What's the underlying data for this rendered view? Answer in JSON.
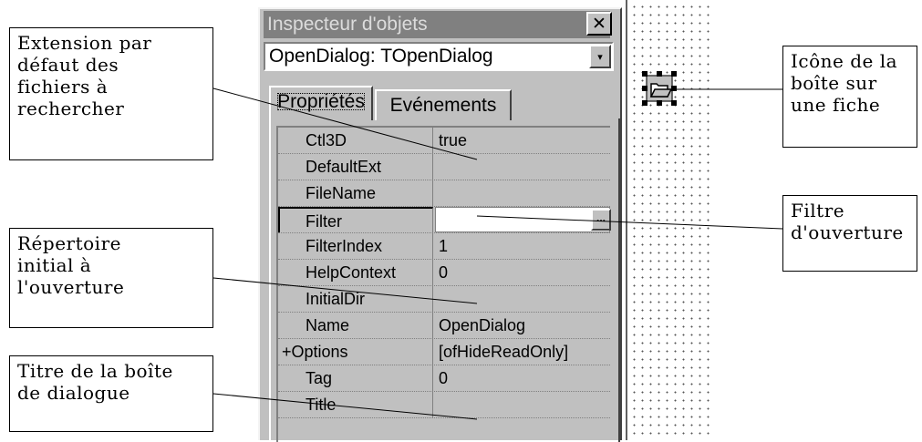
{
  "inspector": {
    "title": "Inspecteur d'objets",
    "close_glyph": "✕",
    "object_selector": {
      "value": "OpenDialog: TOpenDialog",
      "arrow_glyph": "▾"
    },
    "tabs": [
      {
        "label": "Propriétés",
        "active": true
      },
      {
        "label": "Evénements",
        "active": false
      }
    ],
    "properties": [
      {
        "name": "Ctl3D",
        "value": "true"
      },
      {
        "name": "DefaultExt",
        "value": ""
      },
      {
        "name": "FileName",
        "value": ""
      },
      {
        "name": "Filter",
        "value": "",
        "selected": true,
        "ellipsis": "..."
      },
      {
        "name": "FilterIndex",
        "value": "1"
      },
      {
        "name": "HelpContext",
        "value": "0"
      },
      {
        "name": "InitialDir",
        "value": ""
      },
      {
        "name": "Name",
        "value": "OpenDialog"
      },
      {
        "name": "+Options",
        "value": "[ofHideReadOnly]"
      },
      {
        "name": "Tag",
        "value": "0"
      },
      {
        "name": "Title",
        "value": ""
      }
    ]
  },
  "annotations": {
    "default_ext": [
      "Extension par",
      "défaut des",
      "fichiers à",
      "rechercher"
    ],
    "initial_dir": [
      "Répertoire",
      "initial à",
      "l'ouverture"
    ],
    "title": [
      "Titre de la boîte",
      "de dialogue"
    ],
    "icon": [
      "Icône de la",
      "boîte sur",
      "une fiche"
    ],
    "filter": [
      "Filtre",
      "d'ouverture"
    ]
  },
  "colors": {
    "window_face": "#c0c0c0",
    "titlebar_inactive": "#808080",
    "title_text": "#dcdcdc"
  },
  "icons": {
    "form_component": "open-dialog-component-icon"
  }
}
